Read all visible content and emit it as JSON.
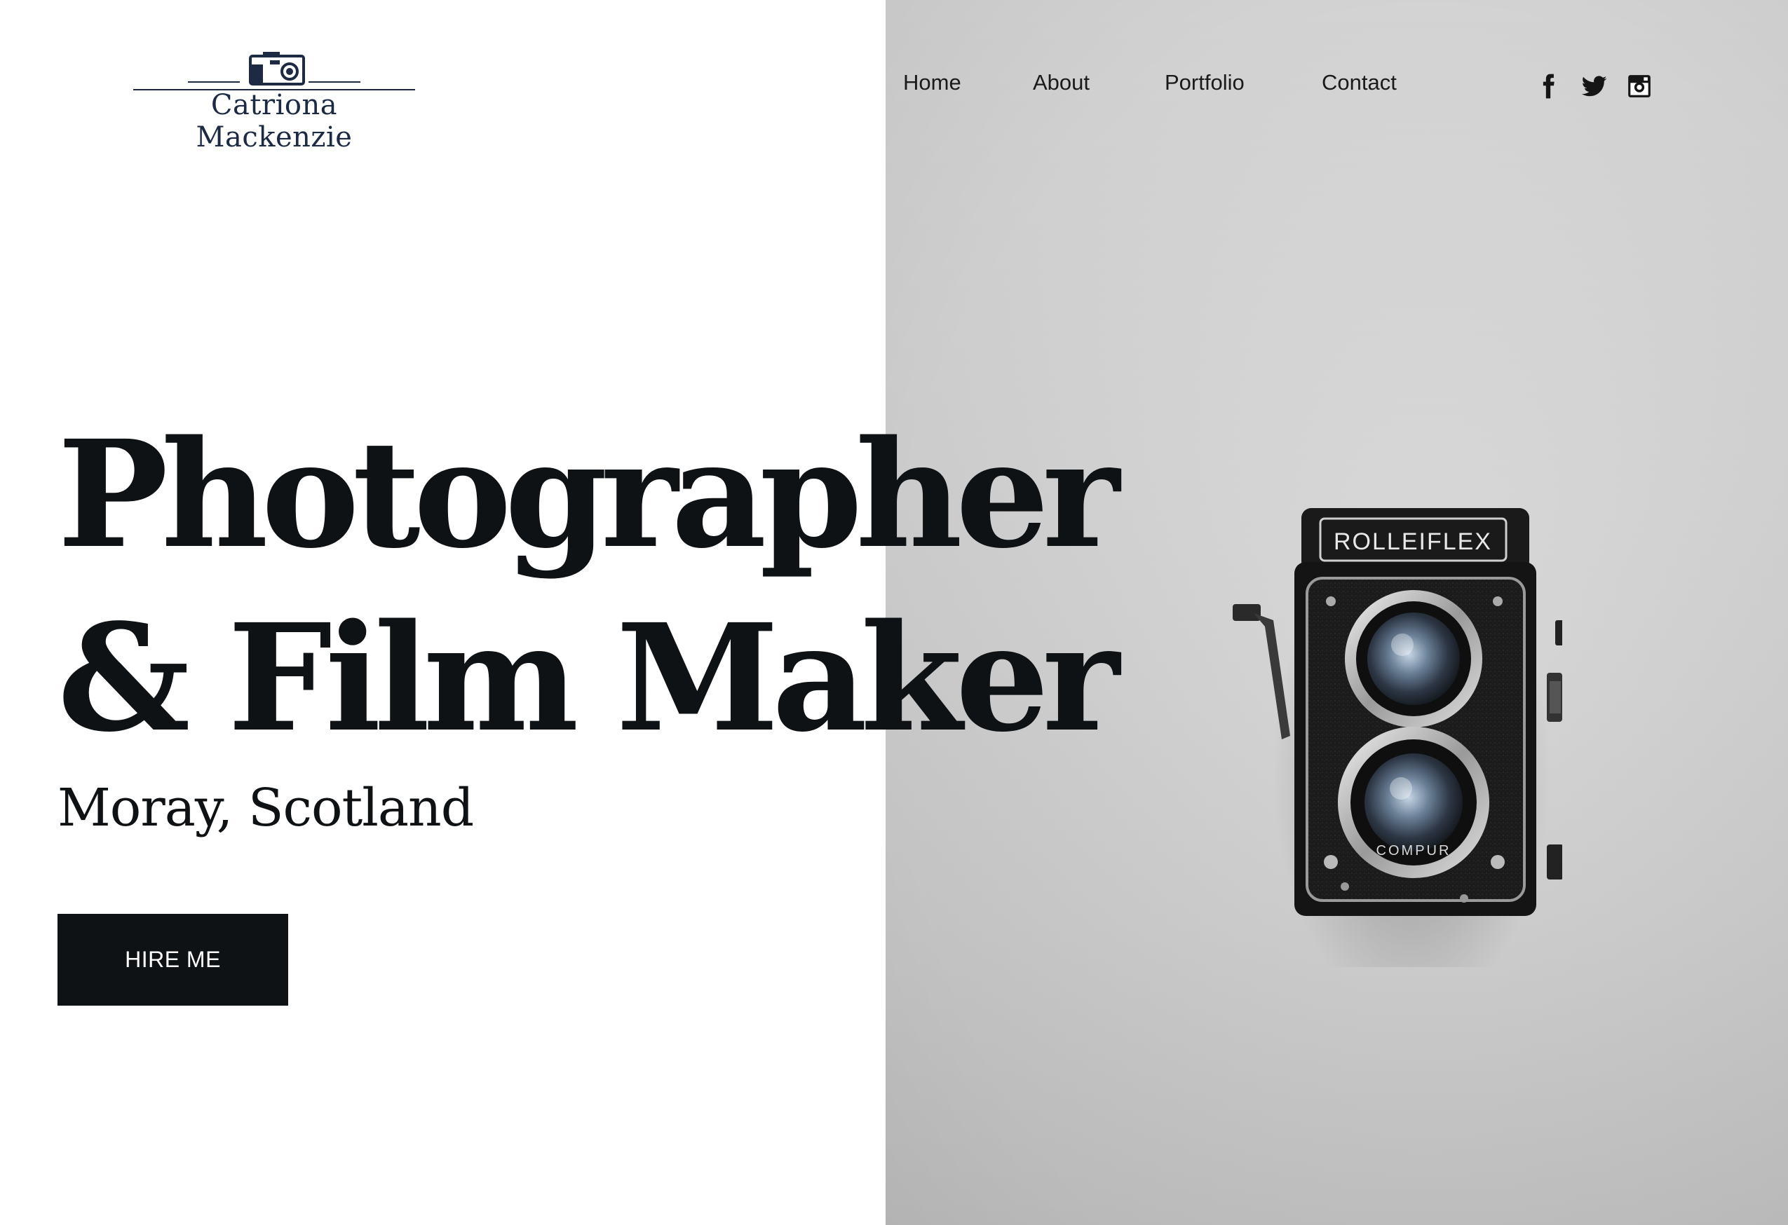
{
  "brand": {
    "name": "Catriona Mackenzie",
    "logo_icon": "camera-icon",
    "color": "#1d2a44"
  },
  "nav": {
    "items": [
      {
        "label": "Home"
      },
      {
        "label": "About"
      },
      {
        "label": "Portfolio"
      },
      {
        "label": "Contact"
      }
    ]
  },
  "social": [
    {
      "icon": "facebook-icon"
    },
    {
      "icon": "twitter-icon"
    },
    {
      "icon": "instagram-icon"
    }
  ],
  "hero": {
    "headline_line1": "Photographer",
    "headline_line2": "& Film Maker",
    "location": "Moray, Scotland",
    "cta_label": "HIRE ME",
    "image": {
      "subject": "camera-photo",
      "camera_brand_text": "ROLLEIFLEX",
      "lens_text": "COMPUR"
    },
    "text_color": "#0f1214",
    "cta_background": "#0f1214"
  }
}
